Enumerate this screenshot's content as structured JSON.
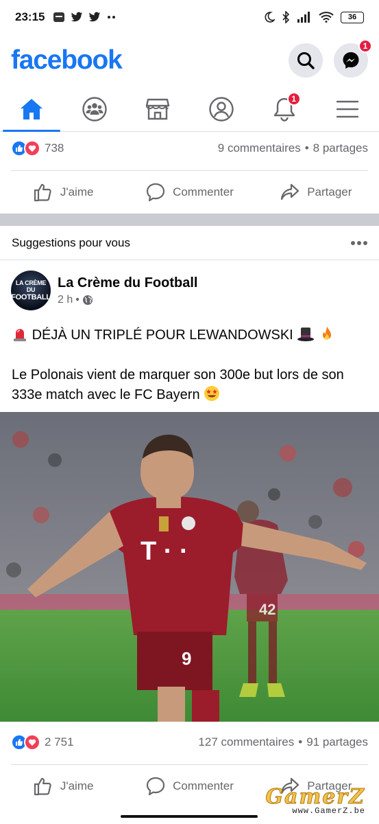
{
  "status_bar": {
    "time": "23:15",
    "battery": "36"
  },
  "header": {
    "brand": "facebook",
    "messenger_badge": "1"
  },
  "tabs": [
    {
      "name": "home",
      "active": true
    },
    {
      "name": "groups"
    },
    {
      "name": "marketplace"
    },
    {
      "name": "profile"
    },
    {
      "name": "notifications",
      "badge": "1"
    },
    {
      "name": "menu"
    }
  ],
  "post1": {
    "reactions_count": "738",
    "comments": "9 commentaires",
    "shares": "8 partages"
  },
  "actions": {
    "like": "J'aime",
    "comment": "Commenter",
    "share": "Partager"
  },
  "suggestions": {
    "title": "Suggestions pour vous"
  },
  "post2": {
    "avatar_line1": "LA CRÈME DU",
    "avatar_line2": "FOOTBALL",
    "author": "La Crème du Football",
    "time": "2 h",
    "headline": "DÉJÀ UN TRIPLÉ POUR LEWANDOWSKI",
    "body": "Le Polonais vient de marquer son 300e but lors de son 333e match avec le FC Bayern",
    "jersey_number": "9",
    "reactions_count": "2 751",
    "comments": "127 commentaires",
    "shares": "91 partages"
  },
  "watermark": {
    "main": "GamerZ",
    "sub": "www.GamerZ.be"
  },
  "colors": {
    "brand": "#1877f2",
    "badge": "#e41e3f",
    "love": "#f33e58",
    "jersey": "#9b1c2b"
  }
}
